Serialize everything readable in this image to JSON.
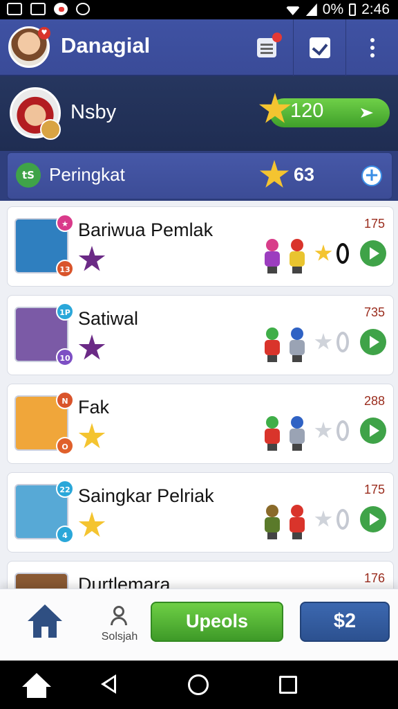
{
  "status_bar": {
    "battery": "0%",
    "time": "2:46"
  },
  "app": {
    "title": "Danagial"
  },
  "profile": {
    "name": "Nsby",
    "score": "120"
  },
  "rank": {
    "label": "Peringkat",
    "value": "63",
    "icon_text": "tS"
  },
  "players": [
    {
      "name": "Bariwua Pemlak",
      "points": "175",
      "star_color": "#6b2a86",
      "top_badge": "★",
      "bottom_badge": "13",
      "avatar_bg": "#2f7fbf"
    },
    {
      "name": "Satiwal",
      "points": "735",
      "star_color": "#6b2a86",
      "top_badge": "1P",
      "bottom_badge": "10",
      "avatar_bg": "#7b5aa6"
    },
    {
      "name": "Fak",
      "points": "288",
      "star_color": "#f4c430",
      "top_badge": "N",
      "bottom_badge": "O",
      "avatar_bg": "#f0a63a"
    },
    {
      "name": "Saingkar Pelriak",
      "points": "175",
      "star_color": "#f4c430",
      "top_badge": "22",
      "bottom_badge": "4",
      "avatar_bg": "#57a9d6"
    },
    {
      "name": "Durtlemara",
      "points": "176",
      "star_color": "#f4c430",
      "top_badge": "",
      "bottom_badge": "",
      "avatar_bg": "#8a5a34"
    }
  ],
  "bottom_nav": {
    "profile_label": "Solsjah",
    "primary_button": "Upeols",
    "price_button": "$2"
  },
  "colors": {
    "header": "#3f52a3",
    "accent_green": "#3fa348",
    "points": "#9a2c1d",
    "blue_button": "#2c5190"
  }
}
